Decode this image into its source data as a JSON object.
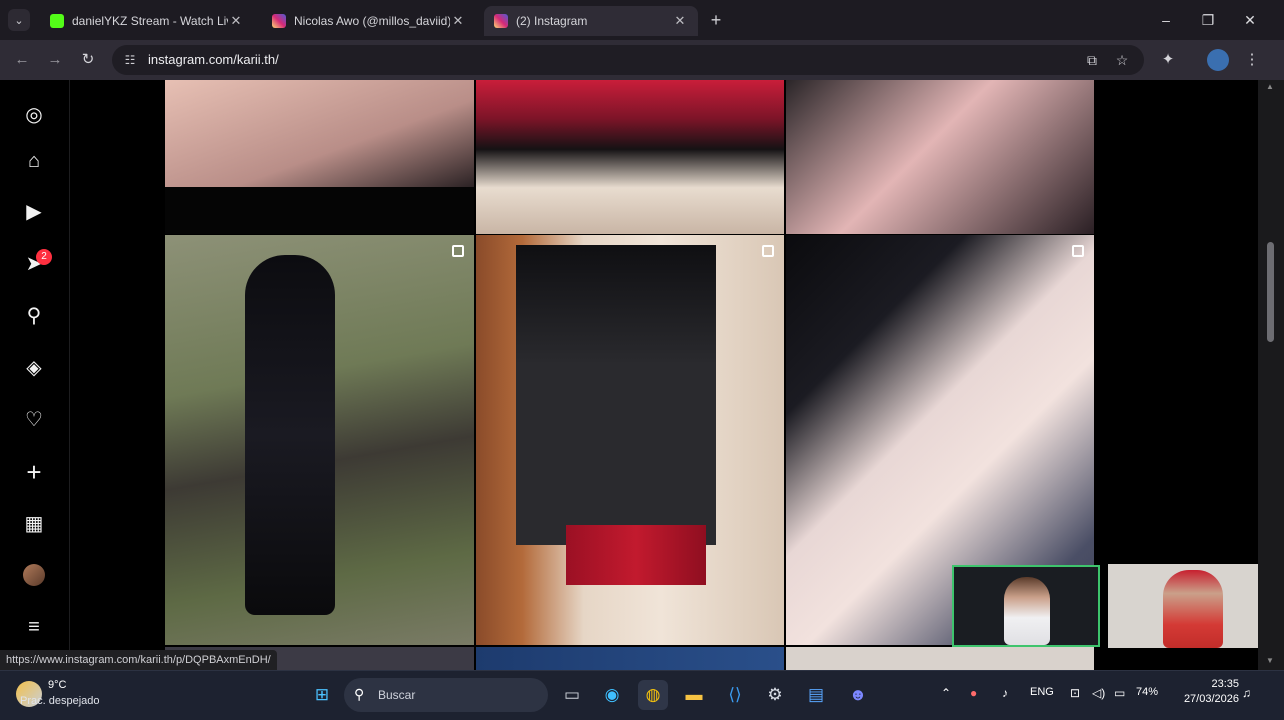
{
  "browser": {
    "tabs": [
      {
        "label": "danielYKZ Stream - Watch Live",
        "favicon_color": "#53fc18",
        "active": false
      },
      {
        "label": "Nicolas Awo (@millos_daviid) -",
        "favicon_color": "#e1306c",
        "active": false
      },
      {
        "label": "(2) Instagram",
        "favicon_color": "#e1306c",
        "active": true
      }
    ],
    "new_tab_glyph": "+",
    "url": "instagram.com/karii.th/",
    "status_url": "https://www.instagram.com/karii.th/p/DQPBAxmEnDH/"
  },
  "sidebar": {
    "items": [
      {
        "name": "instagram-logo-icon",
        "glyph": "◎"
      },
      {
        "name": "home-icon",
        "glyph": "⌂"
      },
      {
        "name": "reels-icon",
        "glyph": "▶"
      },
      {
        "name": "messages-icon",
        "glyph": "➤"
      },
      {
        "name": "search-icon",
        "glyph": "⚲"
      },
      {
        "name": "explore-icon",
        "glyph": "◈"
      },
      {
        "name": "notifications-icon",
        "glyph": "♡"
      },
      {
        "name": "create-icon",
        "glyph": "+"
      },
      {
        "name": "dashboard-icon",
        "glyph": "▦"
      },
      {
        "name": "profile-avatar",
        "glyph": ""
      },
      {
        "name": "more-menu-icon",
        "glyph": "≡"
      }
    ],
    "messages_badge": "2"
  },
  "taskbar": {
    "weather_temp": "9°C",
    "weather_desc": "Prac. despejado",
    "search_placeholder": "Buscar",
    "language": "ENG",
    "battery": "74%",
    "time": "23:35",
    "date": "27/03/2026"
  }
}
